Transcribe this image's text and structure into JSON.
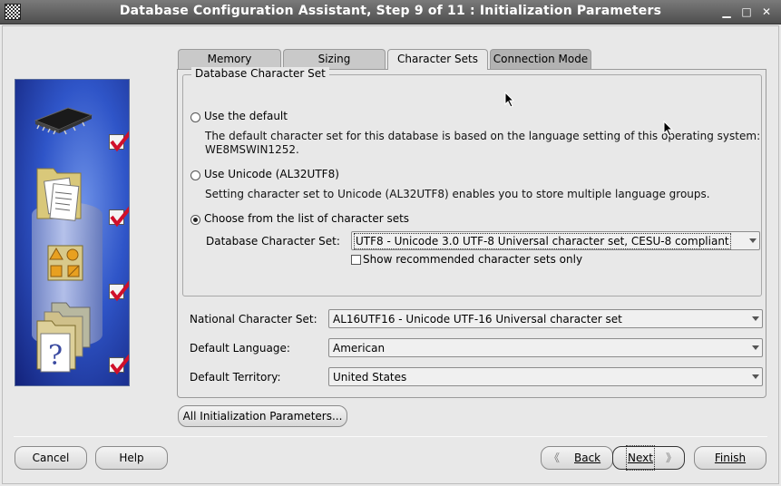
{
  "window": {
    "title": "Database Configuration Assistant, Step 9 of 11 : Initialization Parameters",
    "controls": {
      "minimize": "▁",
      "maximize": "□",
      "close": "✕"
    }
  },
  "tabs": [
    {
      "label": "Memory",
      "selected": false
    },
    {
      "label": "Sizing",
      "selected": false
    },
    {
      "label": "Character Sets",
      "selected": true
    },
    {
      "label": "Connection Mode",
      "selected": false
    }
  ],
  "charset_group": {
    "legend": "Database Character Set",
    "options": [
      {
        "label": "Use the default",
        "selected": false,
        "description_line1": "The default character set for this database is based on the language setting of this operating system:",
        "description_line2": "WE8MSWIN1252."
      },
      {
        "label": "Use Unicode (AL32UTF8)",
        "selected": false,
        "description_line1": "Setting character set to Unicode (AL32UTF8) enables you to store multiple language groups."
      },
      {
        "label": "Choose from the list of character sets",
        "selected": true
      }
    ],
    "db_charset_label": "Database Character Set:",
    "db_charset_value": "UTF8 - Unicode 3.0 UTF-8 Universal character set, CESU-8 compliant",
    "show_recommended_label": "Show recommended character sets only",
    "show_recommended_checked": false
  },
  "fields": {
    "national_label": "National Character Set:",
    "national_value": "AL16UTF16 - Unicode UTF-16 Universal character set",
    "language_label": "Default Language:",
    "language_value": "American",
    "territory_label": "Default Territory:",
    "territory_value": "United States"
  },
  "all_params_button": "All Initialization Parameters...",
  "footer": {
    "cancel": "Cancel",
    "help": "Help",
    "back": "Back",
    "next": "Next",
    "finish": "Finish"
  },
  "colors": {
    "title_bar": "#5a5a5a",
    "side_panel": "#2f55c8",
    "check_mark": "#d0102a"
  }
}
